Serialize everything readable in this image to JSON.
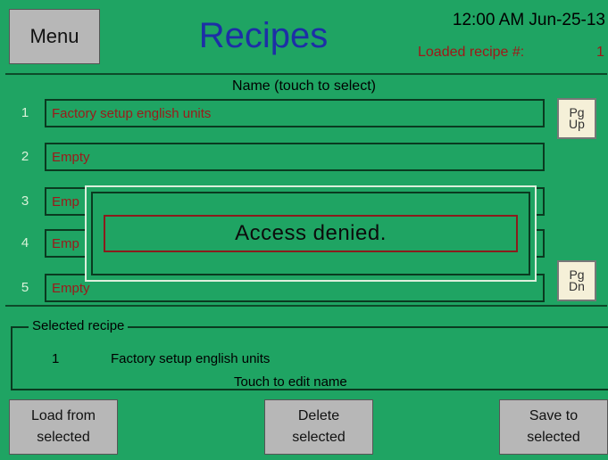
{
  "header": {
    "menu_label": "Menu",
    "title": "Recipes",
    "clock": "12:00 AM Jun-25-13",
    "loaded_label": "Loaded recipe #:",
    "loaded_number": "1"
  },
  "list": {
    "column_header": "Name (touch to select)",
    "rows": [
      {
        "num": "1",
        "name": "Factory setup english units"
      },
      {
        "num": "2",
        "name": "Empty"
      },
      {
        "num": "3",
        "name": "Emp"
      },
      {
        "num": "4",
        "name": "Emp"
      },
      {
        "num": "5",
        "name": "Empty"
      }
    ],
    "pg_up": [
      "Pg",
      "Up"
    ],
    "pg_dn": [
      "Pg",
      "Dn"
    ]
  },
  "dialog": {
    "message": "Access denied."
  },
  "selected": {
    "legend": "Selected recipe",
    "num": "1",
    "name": "Factory setup english units",
    "hint": "Touch to edit name"
  },
  "buttons": {
    "load": [
      "Load from",
      "selected"
    ],
    "delete": [
      "Delete",
      "selected"
    ],
    "save": [
      "Save to",
      "selected"
    ]
  },
  "colors": {
    "background": "#1fa463",
    "title": "#1d2fa6",
    "field_text": "#9c1a1a",
    "button": "#b7b7b7",
    "page_button": "#f5f0d8"
  }
}
